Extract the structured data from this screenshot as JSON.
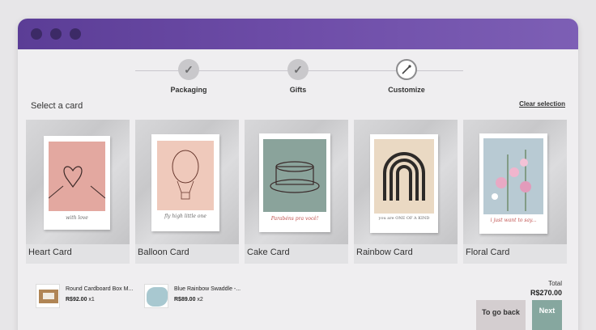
{
  "steps": [
    {
      "label": "Packaging",
      "icon": "check-icon",
      "state": "done"
    },
    {
      "label": "Gifts",
      "icon": "check-icon",
      "state": "done"
    },
    {
      "label": "Customize",
      "icon": "brush-icon",
      "state": "active"
    }
  ],
  "section": {
    "title": "Select a card",
    "clear_label": "Clear selection"
  },
  "cards": [
    {
      "name": "Heart Card",
      "caption": "with love",
      "paper_color": "#e3a8a0"
    },
    {
      "name": "Balloon Card",
      "caption": "fly high little one",
      "paper_color": "#efc9bb"
    },
    {
      "name": "Cake Card",
      "caption": "Parabéns pra você!",
      "paper_color": "#8aa39b"
    },
    {
      "name": "Rainbow Card",
      "caption": "you are ONE OF A KIND",
      "paper_color": "#ead9c3"
    },
    {
      "name": "Floral Card",
      "caption": "i just want to say...",
      "paper_color": "#b8cad3"
    }
  ],
  "cart": [
    {
      "name": "Round Cardboard Box M...",
      "price": "R$92.00",
      "qty": "x1",
      "icon": "box-thumbnail"
    },
    {
      "name": "Blue Rainbow Swaddle -...",
      "price": "R$89.00",
      "qty": "x2",
      "icon": "swaddle-thumbnail"
    }
  ],
  "total": {
    "label": "Total",
    "value": "R$270.00"
  },
  "buttons": {
    "back": "To go back",
    "next": "Next"
  },
  "colors": {
    "titlebar": "#6e4da8",
    "next_button": "#86a79f",
    "back_button": "#d4ced0"
  }
}
